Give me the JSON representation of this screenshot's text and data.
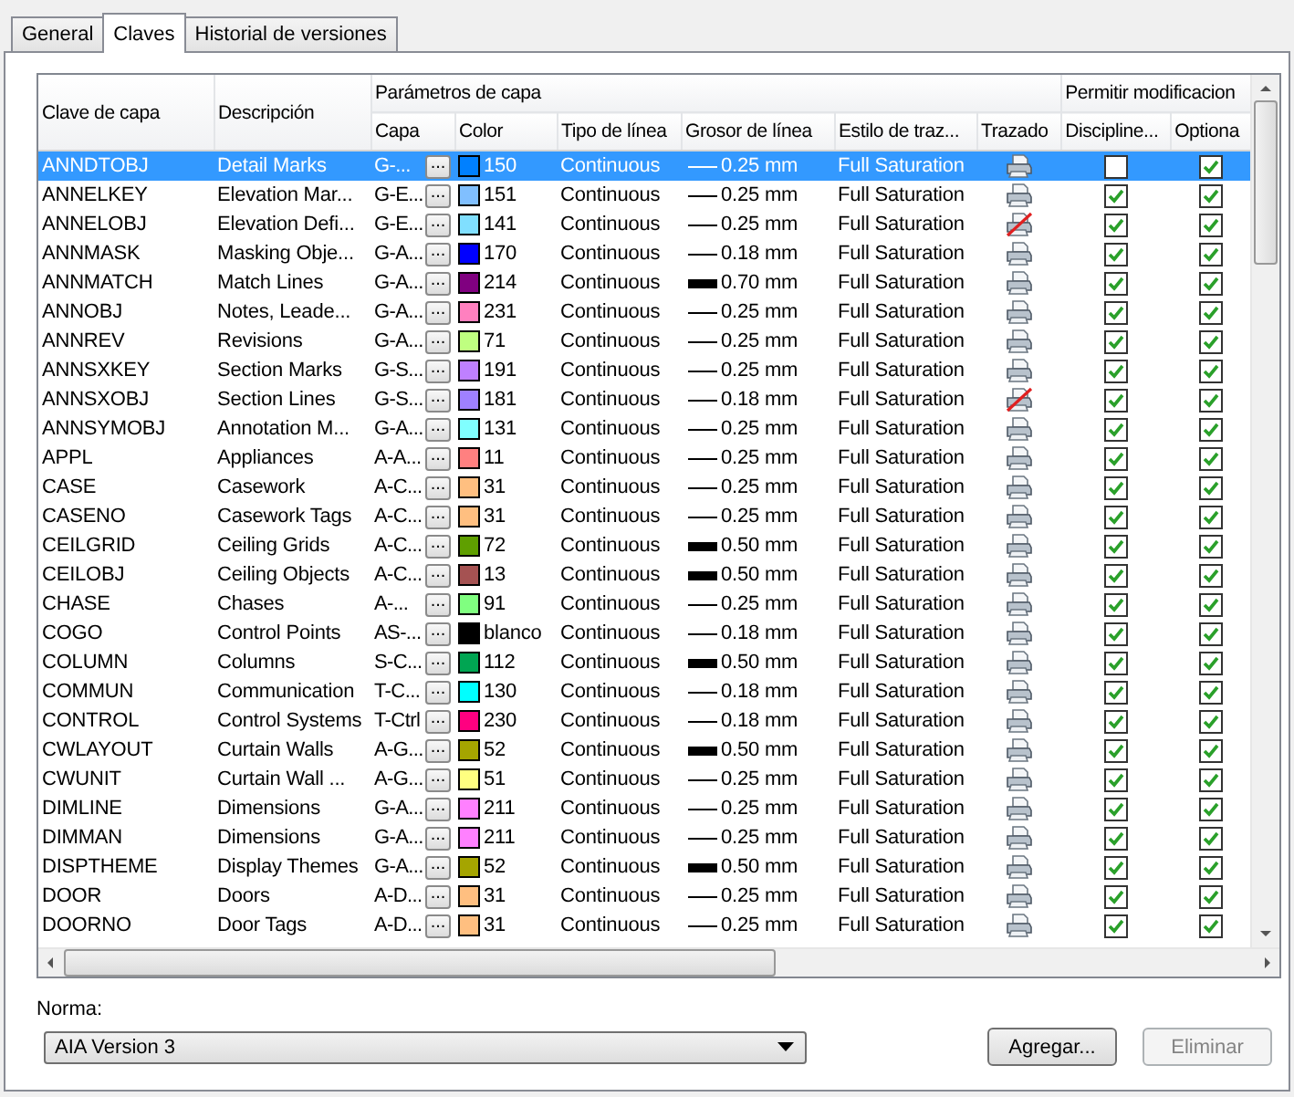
{
  "tabs": [
    {
      "label": "General",
      "selected": false
    },
    {
      "label": "Claves",
      "selected": true
    },
    {
      "label": "Historial de versiones",
      "selected": false
    }
  ],
  "table": {
    "header_groups": {
      "key": "Clave de capa",
      "description": "Descripción",
      "params": "Parámetros de capa",
      "allow": "Permitir modificacion"
    },
    "columns": {
      "layer": "Capa",
      "color_column": "Color",
      "linetype": "Tipo de línea",
      "lineweight": "Grosor de línea",
      "plot_style": "Estilo de traz...",
      "plot": "Trazado",
      "discipline": "Discipline...",
      "optional": "Optiona"
    },
    "rows": [
      {
        "key": "ANNDTOBJ",
        "description": "Detail Marks",
        "layer": "G-...",
        "button": "...",
        "color_label": "150",
        "color": "#0080ff",
        "linetype": "Continuous",
        "lineweight": "0.25 mm",
        "thick": false,
        "plot_style": "Full Saturation",
        "plot": true,
        "discipline": false,
        "optional": true,
        "selected": true
      },
      {
        "key": "ANNELKEY",
        "description": "Elevation Mar...",
        "layer": "G-E...",
        "button": "...",
        "color_label": "151",
        "color": "#80bfff",
        "linetype": "Continuous",
        "lineweight": "0.25 mm",
        "thick": false,
        "plot_style": "Full Saturation",
        "plot": true,
        "discipline": true,
        "optional": true,
        "selected": false
      },
      {
        "key": "ANNELOBJ",
        "description": "Elevation Defi...",
        "layer": "G-E...",
        "button": "...",
        "color_label": "141",
        "color": "#80dfff",
        "linetype": "Continuous",
        "lineweight": "0.25 mm",
        "thick": false,
        "plot_style": "Full Saturation",
        "plot": false,
        "discipline": true,
        "optional": true,
        "selected": false
      },
      {
        "key": "ANNMASK",
        "description": "Masking Obje...",
        "layer": "G-A...",
        "button": "...",
        "color_label": "170",
        "color": "#0000ff",
        "linetype": "Continuous",
        "lineweight": "0.18 mm",
        "thick": false,
        "plot_style": "Full Saturation",
        "plot": true,
        "discipline": true,
        "optional": true,
        "selected": false
      },
      {
        "key": "ANNMATCH",
        "description": "Match Lines",
        "layer": "G-A...",
        "button": "...",
        "color_label": "214",
        "color": "#800080",
        "linetype": "Continuous",
        "lineweight": "0.70 mm",
        "thick": true,
        "plot_style": "Full Saturation",
        "plot": true,
        "discipline": true,
        "optional": true,
        "selected": false
      },
      {
        "key": "ANNOBJ",
        "description": "Notes, Leade...",
        "layer": "G-A...",
        "button": "...",
        "color_label": "231",
        "color": "#ff80bf",
        "linetype": "Continuous",
        "lineweight": "0.25 mm",
        "thick": false,
        "plot_style": "Full Saturation",
        "plot": true,
        "discipline": true,
        "optional": true,
        "selected": false
      },
      {
        "key": "ANNREV",
        "description": "Revisions",
        "layer": "G-A...",
        "button": "...",
        "color_label": "71",
        "color": "#bfff80",
        "linetype": "Continuous",
        "lineweight": "0.25 mm",
        "thick": false,
        "plot_style": "Full Saturation",
        "plot": true,
        "discipline": true,
        "optional": true,
        "selected": false
      },
      {
        "key": "ANNSXKEY",
        "description": "Section Marks",
        "layer": "G-S...",
        "button": "...",
        "color_label": "191",
        "color": "#bf80ff",
        "linetype": "Continuous",
        "lineweight": "0.25 mm",
        "thick": false,
        "plot_style": "Full Saturation",
        "plot": true,
        "discipline": true,
        "optional": true,
        "selected": false
      },
      {
        "key": "ANNSXOBJ",
        "description": "Section Lines",
        "layer": "G-S...",
        "button": "...",
        "color_label": "181",
        "color": "#9f80ff",
        "linetype": "Continuous",
        "lineweight": "0.18 mm",
        "thick": false,
        "plot_style": "Full Saturation",
        "plot": false,
        "discipline": true,
        "optional": true,
        "selected": false
      },
      {
        "key": "ANNSYMOBJ",
        "description": "Annotation M...",
        "layer": "G-A...",
        "button": "...",
        "color_label": "131",
        "color": "#80ffff",
        "linetype": "Continuous",
        "lineweight": "0.25 mm",
        "thick": false,
        "plot_style": "Full Saturation",
        "plot": true,
        "discipline": true,
        "optional": true,
        "selected": false
      },
      {
        "key": "APPL",
        "description": "Appliances",
        "layer": "A-A...",
        "button": "...",
        "color_label": "11",
        "color": "#ff8080",
        "linetype": "Continuous",
        "lineweight": "0.25 mm",
        "thick": false,
        "plot_style": "Full Saturation",
        "plot": true,
        "discipline": true,
        "optional": true,
        "selected": false
      },
      {
        "key": "CASE",
        "description": "Casework",
        "layer": "A-C...",
        "button": "...",
        "color_label": "31",
        "color": "#ffbf80",
        "linetype": "Continuous",
        "lineweight": "0.25 mm",
        "thick": false,
        "plot_style": "Full Saturation",
        "plot": true,
        "discipline": true,
        "optional": true,
        "selected": false
      },
      {
        "key": "CASENO",
        "description": "Casework Tags",
        "layer": "A-C...",
        "button": "...",
        "color_label": "31",
        "color": "#ffbf80",
        "linetype": "Continuous",
        "lineweight": "0.25 mm",
        "thick": false,
        "plot_style": "Full Saturation",
        "plot": true,
        "discipline": true,
        "optional": true,
        "selected": false
      },
      {
        "key": "CEILGRID",
        "description": "Ceiling Grids",
        "layer": "A-C...",
        "button": "...",
        "color_label": "72",
        "color": "#5f9f00",
        "linetype": "Continuous",
        "lineweight": "0.50 mm",
        "thick": true,
        "plot_style": "Full Saturation",
        "plot": true,
        "discipline": true,
        "optional": true,
        "selected": false
      },
      {
        "key": "CEILOBJ",
        "description": "Ceiling Objects",
        "layer": "A-C...",
        "button": "...",
        "color_label": "13",
        "color": "#a55252",
        "linetype": "Continuous",
        "lineweight": "0.50 mm",
        "thick": true,
        "plot_style": "Full Saturation",
        "plot": true,
        "discipline": true,
        "optional": true,
        "selected": false
      },
      {
        "key": "CHASE",
        "description": "Chases",
        "layer": "A-...",
        "button": "...",
        "color_label": "91",
        "color": "#80ff80",
        "linetype": "Continuous",
        "lineweight": "0.25 mm",
        "thick": false,
        "plot_style": "Full Saturation",
        "plot": true,
        "discipline": true,
        "optional": true,
        "selected": false
      },
      {
        "key": "COGO",
        "description": "Control Points",
        "layer": "AS-...",
        "button": "...",
        "color_label": "blanco",
        "color": "#000000",
        "linetype": "Continuous",
        "lineweight": "0.18 mm",
        "thick": false,
        "plot_style": "Full Saturation",
        "plot": true,
        "discipline": true,
        "optional": true,
        "selected": false
      },
      {
        "key": "COLUMN",
        "description": "Columns",
        "layer": "S-C...",
        "button": "...",
        "color_label": "112",
        "color": "#00a552",
        "linetype": "Continuous",
        "lineweight": "0.50 mm",
        "thick": true,
        "plot_style": "Full Saturation",
        "plot": true,
        "discipline": true,
        "optional": true,
        "selected": false
      },
      {
        "key": "COMMUN",
        "description": "Communication",
        "layer": "T-C...",
        "button": "...",
        "color_label": "130",
        "color": "#00ffff",
        "linetype": "Continuous",
        "lineweight": "0.18 mm",
        "thick": false,
        "plot_style": "Full Saturation",
        "plot": true,
        "discipline": true,
        "optional": true,
        "selected": false
      },
      {
        "key": "CONTROL",
        "description": "Control Systems",
        "layer": "T-Ctrl",
        "button": "...",
        "color_label": "230",
        "color": "#ff0080",
        "linetype": "Continuous",
        "lineweight": "0.18 mm",
        "thick": false,
        "plot_style": "Full Saturation",
        "plot": true,
        "discipline": true,
        "optional": true,
        "selected": false
      },
      {
        "key": "CWLAYOUT",
        "description": "Curtain Walls",
        "layer": "A-G...",
        "button": "...",
        "color_label": "52",
        "color": "#a5a500",
        "linetype": "Continuous",
        "lineweight": "0.50 mm",
        "thick": true,
        "plot_style": "Full Saturation",
        "plot": true,
        "discipline": true,
        "optional": true,
        "selected": false
      },
      {
        "key": "CWUNIT",
        "description": "Curtain Wall ...",
        "layer": "A-G...",
        "button": "...",
        "color_label": "51",
        "color": "#ffff80",
        "linetype": "Continuous",
        "lineweight": "0.25 mm",
        "thick": false,
        "plot_style": "Full Saturation",
        "plot": true,
        "discipline": true,
        "optional": true,
        "selected": false
      },
      {
        "key": "DIMLINE",
        "description": "Dimensions",
        "layer": "G-A...",
        "button": "...",
        "color_label": "211",
        "color": "#ff80ff",
        "linetype": "Continuous",
        "lineweight": "0.25 mm",
        "thick": false,
        "plot_style": "Full Saturation",
        "plot": true,
        "discipline": true,
        "optional": true,
        "selected": false
      },
      {
        "key": "DIMMAN",
        "description": "Dimensions",
        "layer": "G-A...",
        "button": "...",
        "color_label": "211",
        "color": "#ff80ff",
        "linetype": "Continuous",
        "lineweight": "0.25 mm",
        "thick": false,
        "plot_style": "Full Saturation",
        "plot": true,
        "discipline": true,
        "optional": true,
        "selected": false
      },
      {
        "key": "DISPTHEME",
        "description": "Display Themes",
        "layer": "G-A...",
        "button": "...",
        "color_label": "52",
        "color": "#a5a500",
        "linetype": "Continuous",
        "lineweight": "0.50 mm",
        "thick": true,
        "plot_style": "Full Saturation",
        "plot": true,
        "discipline": true,
        "optional": true,
        "selected": false
      },
      {
        "key": "DOOR",
        "description": "Doors",
        "layer": "A-D...",
        "button": "...",
        "color_label": "31",
        "color": "#ffbf80",
        "linetype": "Continuous",
        "lineweight": "0.25 mm",
        "thick": false,
        "plot_style": "Full Saturation",
        "plot": true,
        "discipline": true,
        "optional": true,
        "selected": false
      },
      {
        "key": "DOORNO",
        "description": "Door Tags",
        "layer": "A-D...",
        "button": "...",
        "color_label": "31",
        "color": "#ffbf80",
        "linetype": "Continuous",
        "lineweight": "0.25 mm",
        "thick": false,
        "plot_style": "Full Saturation",
        "plot": true,
        "discipline": true,
        "optional": true,
        "selected": false
      }
    ]
  },
  "standard": {
    "label": "Norma:",
    "value": "AIA Version 3"
  },
  "buttons": [
    {
      "label": "Agregar...",
      "disabled": false
    },
    {
      "label": "Eliminar",
      "disabled": true
    }
  ]
}
